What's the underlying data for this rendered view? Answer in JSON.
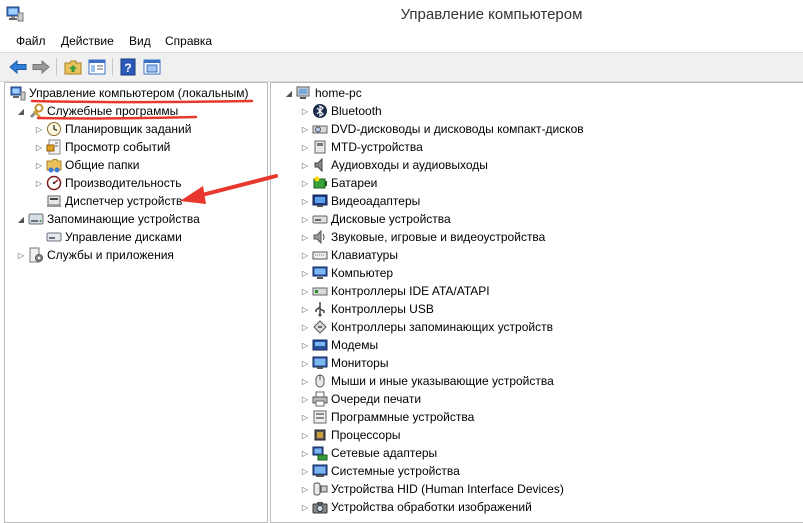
{
  "window": {
    "title": "Управление компьютером"
  },
  "menu": {
    "items": [
      "Файл",
      "Действие",
      "Вид",
      "Справка"
    ]
  },
  "toolbar": {
    "buttons": [
      "back-arrow-icon",
      "forward-arrow-icon",
      "up-folder-icon",
      "show-hide-tree-icon",
      "help-icon",
      "properties-icon"
    ]
  },
  "left_tree": {
    "root": "Управление компьютером (локальным)",
    "system_tools": "Служебные программы",
    "task_scheduler": "Планировщик заданий",
    "event_viewer": "Просмотр событий",
    "shared_folders": "Общие папки",
    "performance": "Производительность",
    "device_manager": "Диспетчер устройств",
    "storage": "Запоминающие устройства",
    "disk_management": "Управление дисками",
    "services": "Службы и приложения"
  },
  "right_tree": {
    "computer": "home-pc",
    "categories": [
      "Bluetooth",
      "DVD-дисководы и дисководы компакт-дисков",
      "MTD-устройства",
      "Аудиовходы и аудиовыходы",
      "Батареи",
      "Видеоадаптеры",
      "Дисковые устройства",
      "Звуковые, игровые и видеоустройства",
      "Клавиатуры",
      "Компьютер",
      "Контроллеры IDE ATA/ATAPI",
      "Контроллеры USB",
      "Контроллеры запоминающих устройств",
      "Модемы",
      "Мониторы",
      "Мыши и иные указывающие устройства",
      "Очереди печати",
      "Программные устройства",
      "Процессоры",
      "Сетевые адаптеры",
      "Системные устройства",
      "Устройства HID (Human Interface Devices)",
      "Устройства обработки изображений"
    ]
  },
  "colors": {
    "annotation": "#e8372c",
    "toolbar_bg": "#f0f0f0",
    "border": "#b9b9b9"
  }
}
